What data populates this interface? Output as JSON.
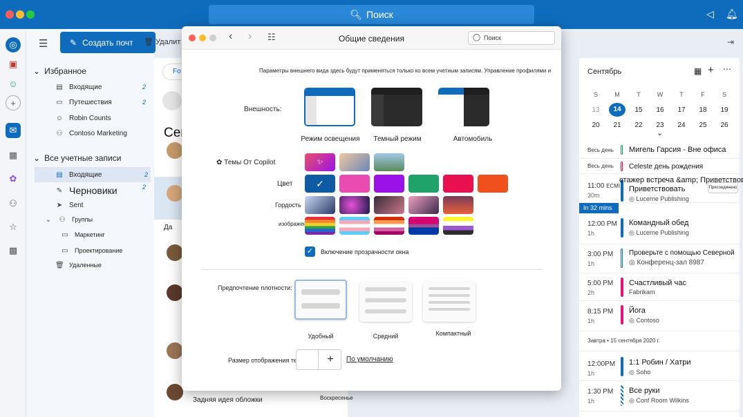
{
  "app": {
    "search_label": "Поиск"
  },
  "toolbar": {
    "new_mail": "Создать почт",
    "delete": "Удалит"
  },
  "folders": {
    "favorites": "Избранное",
    "fav_items": [
      {
        "label": "Входящие",
        "count": "2"
      },
      {
        "label": "Путешествия",
        "count": "2"
      },
      {
        "label": "Robin Counts",
        "count": ""
      },
      {
        "label": "Contoso Marketing",
        "count": ""
      }
    ],
    "all_accounts": "Все учетные записи",
    "acc_items": [
      {
        "label": "Входящие",
        "count": "2"
      },
      {
        "label": "Черновики",
        "count": "2"
      },
      {
        "label": "Sent",
        "count": ""
      }
    ],
    "groups": "Группы",
    "group_items": [
      "Маркетинг",
      "Проектирование"
    ],
    "deleted": "Удаленные"
  },
  "maillist": {
    "tab": "Fo",
    "today": "Сегодня",
    "da": "Да",
    "last_subject": "Задняя идея обложки",
    "last_day": "Воскресенье"
  },
  "dialog": {
    "title": "Общие сведения",
    "search_placeholder": "Поиск",
    "note": "Параметры внешнего вида здесь будут применяться только ко всем учетным записям. Управление профилями и",
    "appearance_label": "Внешность:",
    "modes": [
      "Режим освещения",
      "Темный режим",
      "Автомобиль"
    ],
    "copilot_label": "Темы От Copilot",
    "color_label": "Цвет",
    "pride_label": "Гордость",
    "images_label": "изображения",
    "transparency_label": "Включение прозрачности окна",
    "density_label": "Предпочтение плотности:",
    "densities": [
      "Удобный",
      "Средний",
      "Компактный"
    ],
    "text_size_label": "Размер отображения текста:",
    "text_size_default": "По умолчанию",
    "accent_colors": [
      "#0f5aa5",
      "#e94bb0",
      "#9a12e8",
      "#1fa36b",
      "#e8104f",
      "#f0501e"
    ]
  },
  "calendar": {
    "month": "Сентябрь",
    "dow": [
      "S",
      "M",
      "T",
      "W",
      "T",
      "F",
      "S"
    ],
    "weeks": [
      [
        "13",
        "14",
        "15",
        "16",
        "17",
        "18",
        "19"
      ],
      [
        "20",
        "21",
        "22",
        "23",
        "24",
        "25",
        "26"
      ]
    ],
    "allday": [
      {
        "label": "Весь день",
        "title": "Мигель Гарсия - Вне офиса",
        "color": "#1fa36b"
      },
      {
        "label": "Весь день",
        "title": "Celeste день рождения",
        "color": "#e8104f"
      }
    ],
    "events": [
      {
        "time": "11:00",
        "tz": "ECMI",
        "dur": "30m",
        "title": "стажер встреча &amp; Приветствовать",
        "title2": "Приветствовать",
        "loc": "Lucerne Publishing",
        "badge": "Присоединено",
        "color": "#0f6cbd"
      },
      {
        "time": "12:00 PM",
        "dur": "1h",
        "title": "Командный обед",
        "loc": "Lucerne Publishing",
        "color": "#0f6cbd"
      },
      {
        "time": "3:00 PM",
        "dur": "1h",
        "title": "Проверьте с помощью Северной",
        "loc": "Конференц-зал 8987",
        "color": "#0f6cbd"
      },
      {
        "time": "5:00 PM",
        "dur": "2h",
        "title": "Счастливый час",
        "loc": "Fabrikam",
        "color": "#e8107a"
      },
      {
        "time": "8:15 PM",
        "dur": "1h",
        "title": "Йога",
        "loc": "Contoso",
        "color": "#e8107a"
      }
    ],
    "now_badge": "In 32 mins",
    "tomorrow": "Завтра • 15 сентября 2020 г.",
    "tomorrow_events": [
      {
        "time": "12:00PM",
        "dur": "1h",
        "title": "1:1 Робин / Хатри",
        "loc": "Soho",
        "color": "#0f6cbd"
      },
      {
        "time": "1:30 PM",
        "dur": "1h",
        "title": "Все руки",
        "loc": "Conf Room Wilkins",
        "color": "#0f6cbd"
      }
    ]
  }
}
